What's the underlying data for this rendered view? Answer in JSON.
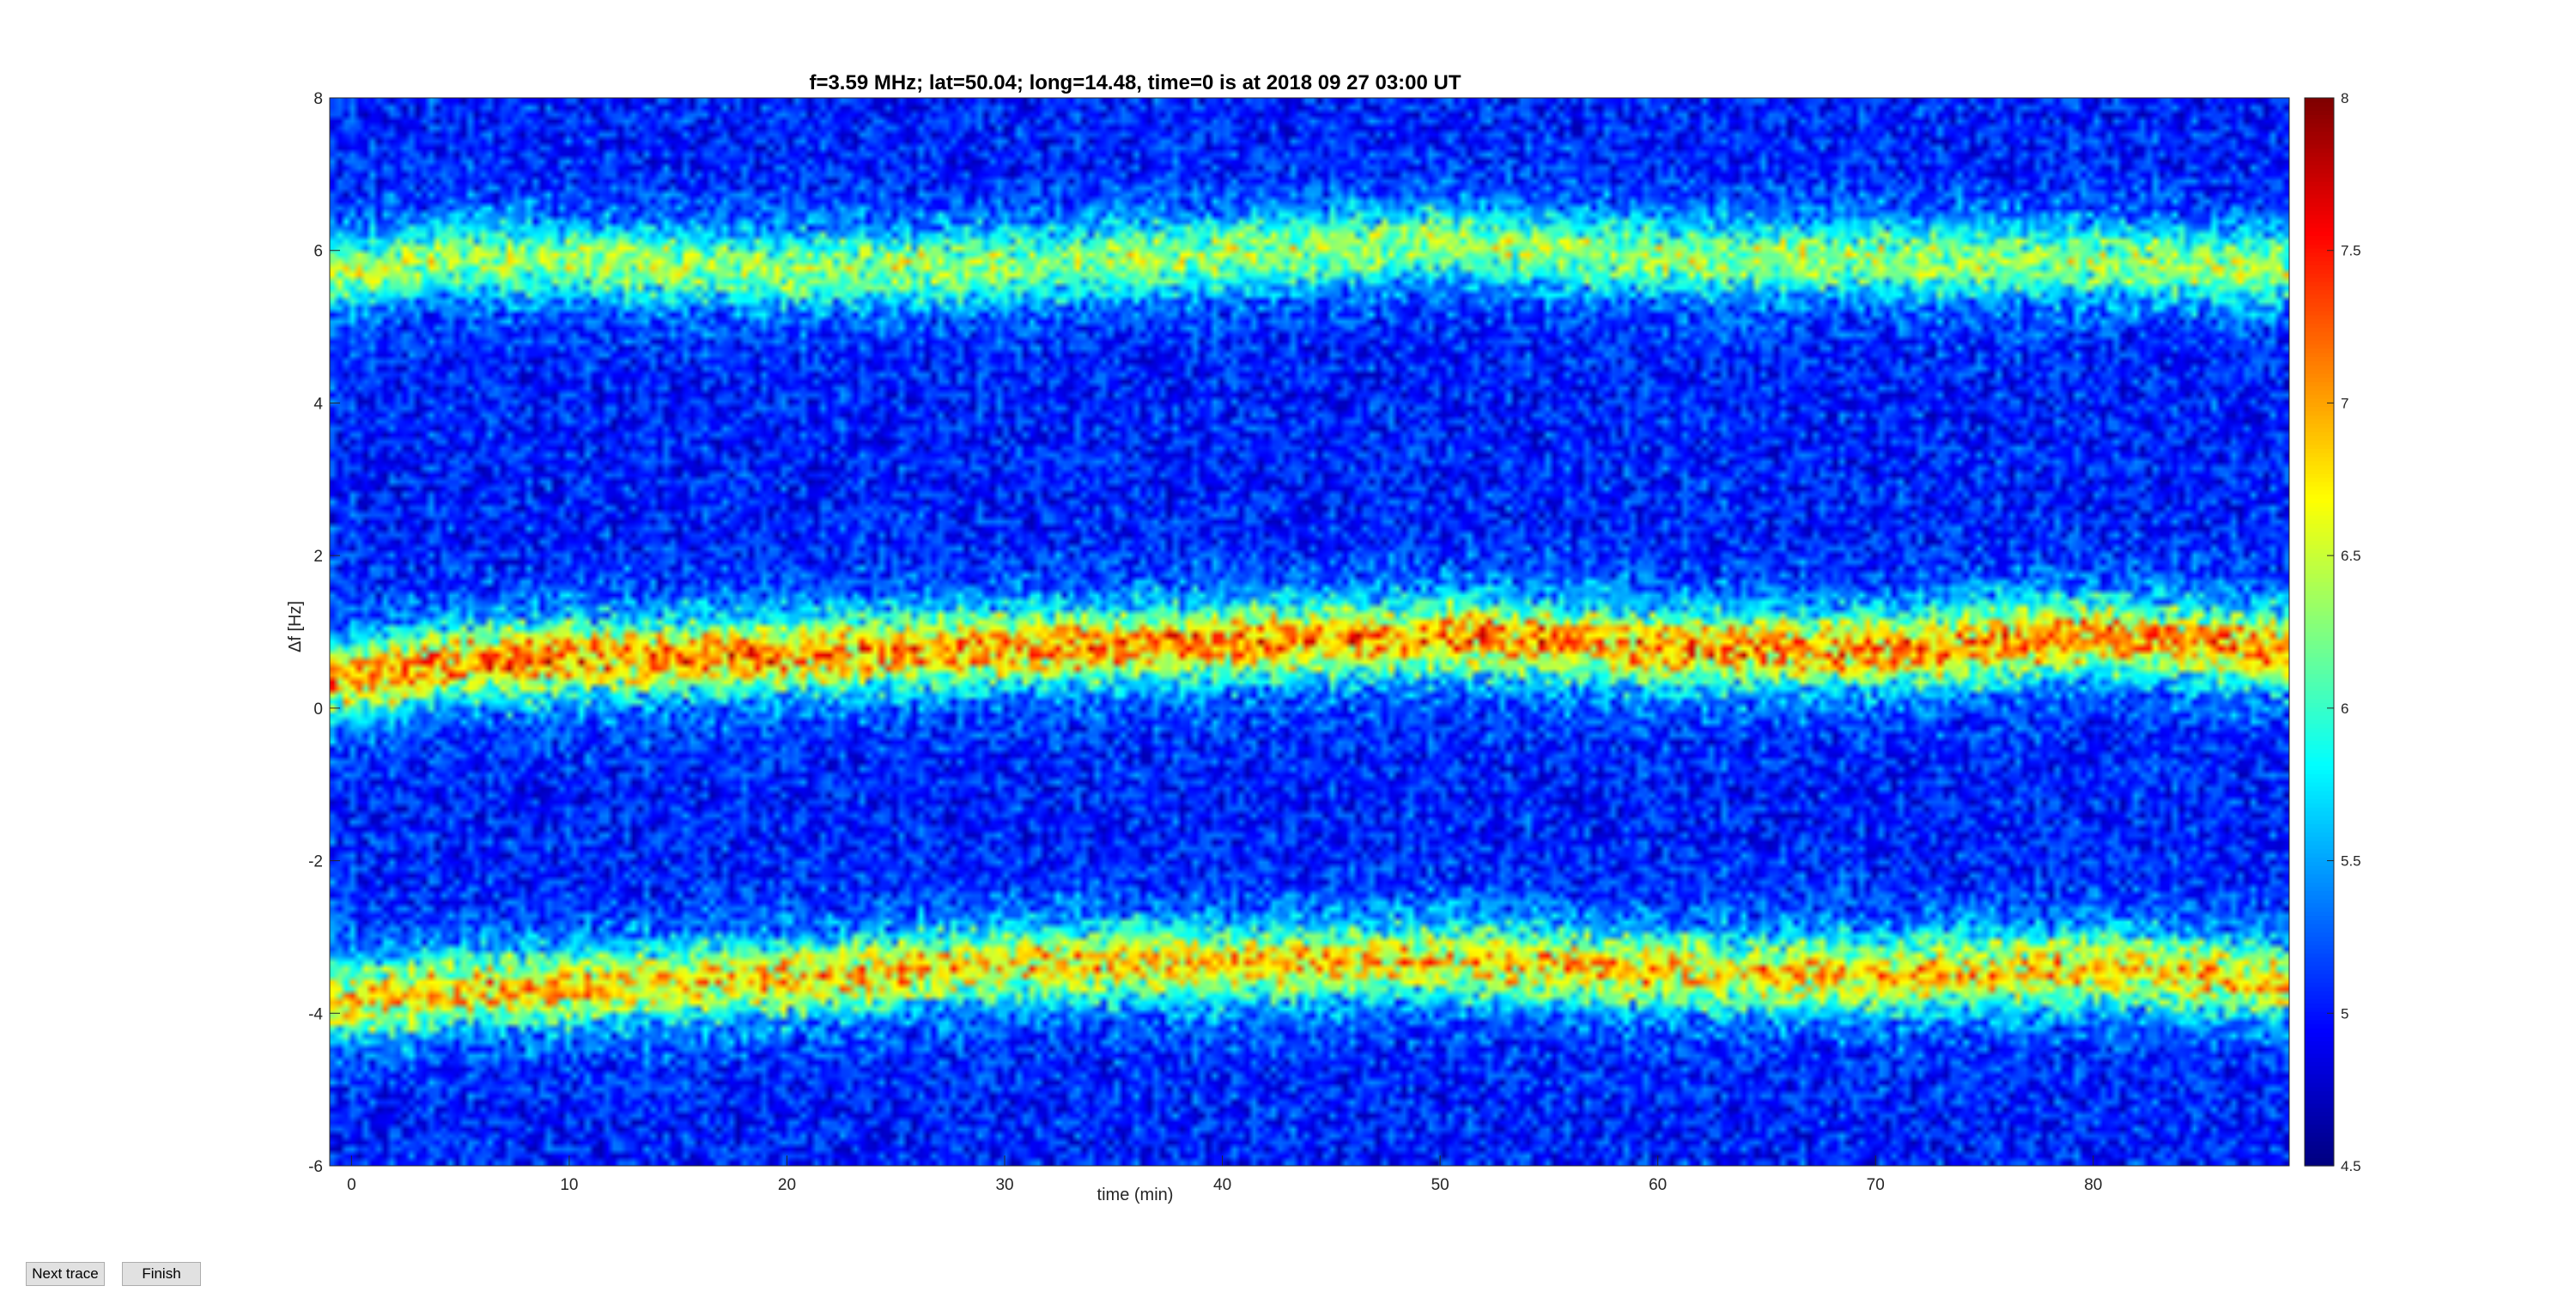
{
  "chart_data": {
    "type": "heatmap",
    "title": "f=3.59 MHz;  lat=50.04; long=14.48, time=0 is at 2018 09 27 03:00 UT",
    "xlabel": "time (min)",
    "ylabel": "Δf [Hz]",
    "xlim": [
      -1,
      89
    ],
    "ylim": [
      -6,
      8
    ],
    "xticks": [
      0,
      10,
      20,
      30,
      40,
      50,
      60,
      70,
      80
    ],
    "yticks": [
      -6,
      -4,
      -2,
      0,
      2,
      4,
      6,
      8
    ],
    "colormap": "jet",
    "clim": [
      4.5,
      8
    ],
    "colorbar_ticks": [
      4.5,
      5,
      5.5,
      6,
      6.5,
      7,
      7.5,
      8
    ],
    "background_level": 5.0,
    "traces": [
      {
        "x": [
          -1,
          5,
          10,
          20,
          30,
          40,
          50,
          60,
          70,
          80,
          89
        ],
        "y": [
          5.7,
          5.9,
          5.85,
          5.75,
          5.8,
          5.95,
          6.1,
          5.9,
          5.9,
          5.85,
          5.75
        ],
        "peak": 6.7
      },
      {
        "x": [
          -1,
          5,
          10,
          20,
          30,
          40,
          50,
          60,
          70,
          80,
          89
        ],
        "y": [
          0.35,
          0.6,
          0.65,
          0.7,
          0.8,
          0.85,
          0.95,
          0.8,
          0.75,
          0.95,
          0.75
        ],
        "peak": 7.6
      },
      {
        "x": [
          -1,
          5,
          10,
          20,
          30,
          40,
          50,
          60,
          70,
          80,
          89
        ],
        "y": [
          -3.85,
          -3.7,
          -3.65,
          -3.55,
          -3.35,
          -3.35,
          -3.3,
          -3.45,
          -3.5,
          -3.4,
          -3.6
        ],
        "peak": 7.3
      }
    ]
  },
  "buttons": {
    "next_trace": "Next trace",
    "finish": "Finish"
  }
}
